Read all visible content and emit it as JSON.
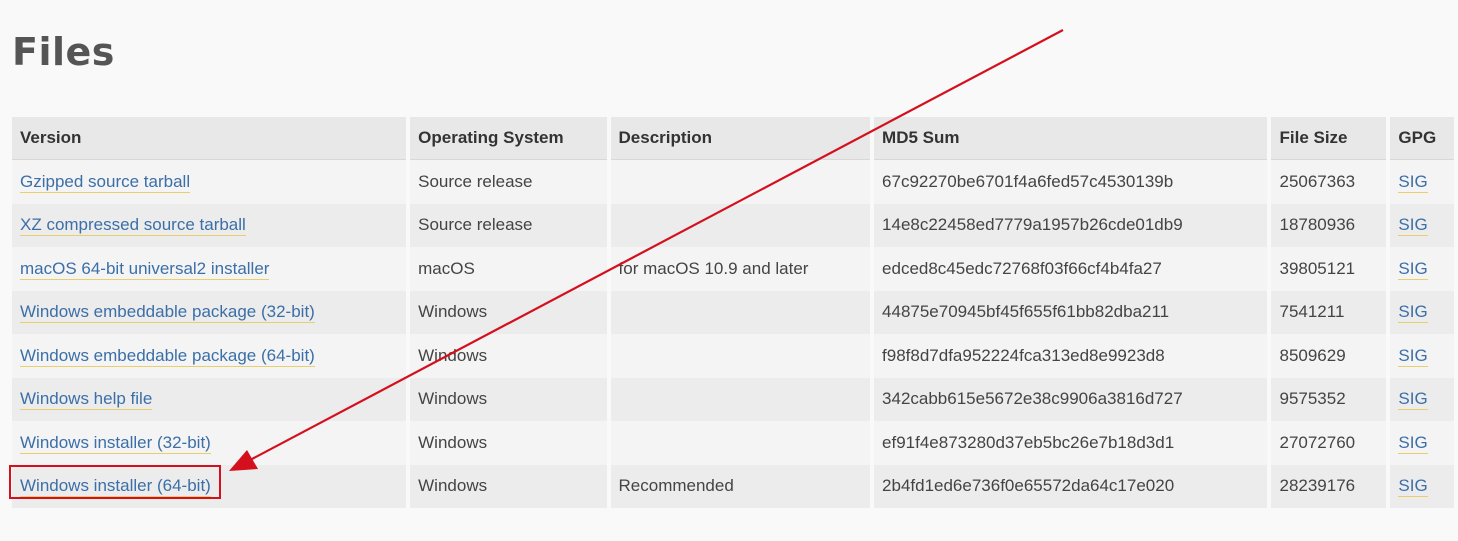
{
  "page": {
    "title": "Files"
  },
  "table": {
    "headers": {
      "version": "Version",
      "os": "Operating System",
      "description": "Description",
      "md5": "MD5 Sum",
      "size": "File Size",
      "gpg": "GPG"
    },
    "rows": [
      {
        "version": "Gzipped source tarball",
        "os": "Source release",
        "description": "",
        "md5": "67c92270be6701f4a6fed57c4530139b",
        "size": "25067363",
        "gpg": "SIG"
      },
      {
        "version": "XZ compressed source tarball",
        "os": "Source release",
        "description": "",
        "md5": "14e8c22458ed7779a1957b26cde01db9",
        "size": "18780936",
        "gpg": "SIG"
      },
      {
        "version": "macOS 64-bit universal2 installer",
        "os": "macOS",
        "description": "for macOS 10.9 and later",
        "md5": "edced8c45edc72768f03f66cf4b4fa27",
        "size": "39805121",
        "gpg": "SIG"
      },
      {
        "version": "Windows embeddable package (32-bit)",
        "os": "Windows",
        "description": "",
        "md5": "44875e70945bf45f655f61bb82dba211",
        "size": "7541211",
        "gpg": "SIG"
      },
      {
        "version": "Windows embeddable package (64-bit)",
        "os": "Windows",
        "description": "",
        "md5": "f98f8d7dfa952224fca313ed8e9923d8",
        "size": "8509629",
        "gpg": "SIG"
      },
      {
        "version": "Windows help file",
        "os": "Windows",
        "description": "",
        "md5": "342cabb615e5672e38c9906a3816d727",
        "size": "9575352",
        "gpg": "SIG"
      },
      {
        "version": "Windows installer (32-bit)",
        "os": "Windows",
        "description": "",
        "md5": "ef91f4e873280d37eb5bc26e7b18d3d1",
        "size": "27072760",
        "gpg": "SIG"
      },
      {
        "version": "Windows installer (64-bit)",
        "os": "Windows",
        "description": "Recommended",
        "md5": "2b4fd1ed6e736f0e65572da64c17e020",
        "size": "28239176",
        "gpg": "SIG"
      }
    ]
  },
  "annotation": {
    "color": "#d4101e"
  },
  "colors": {
    "link": "#3b6fa8",
    "link_underline": "#e6cf6c",
    "header_bg": "#e8e8e8"
  }
}
